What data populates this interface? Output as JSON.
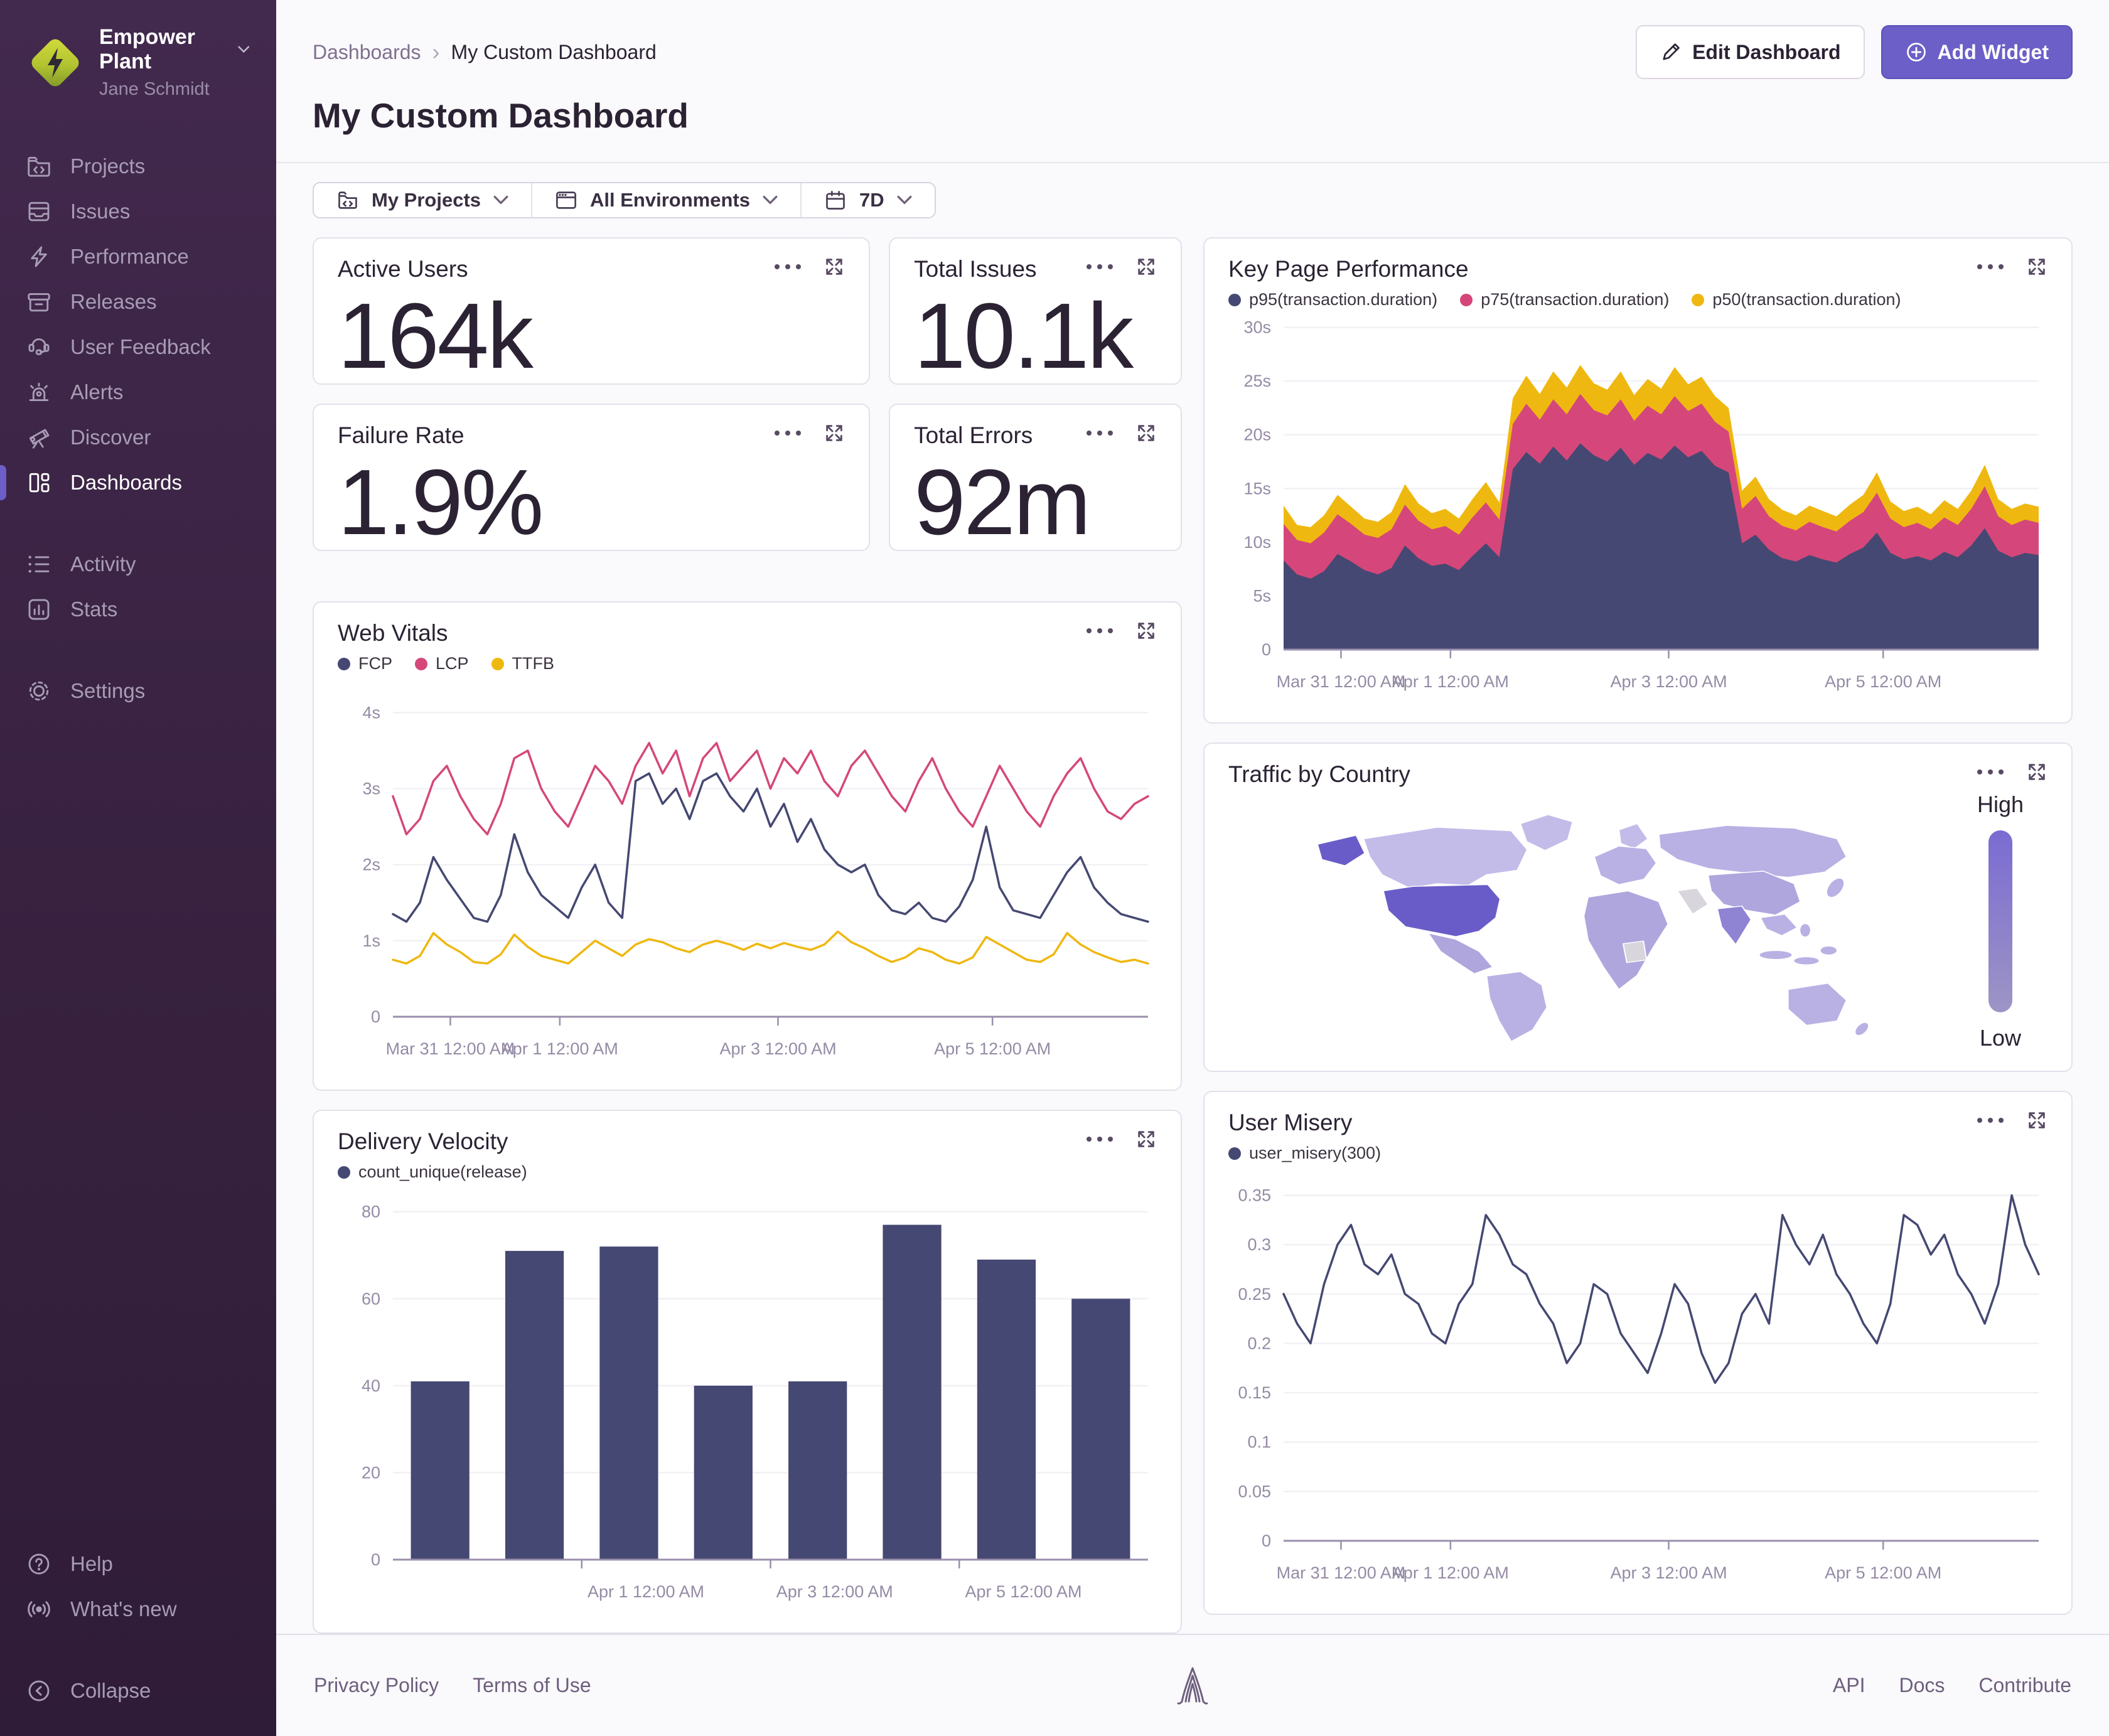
{
  "app": {
    "accent": "#6C5FC7",
    "sidebar_bg": "#37213F",
    "chart_navy": "#454872",
    "chart_pink": "#D5477A",
    "chart_yellow": "#EFB810"
  },
  "sidebar": {
    "org_name": "Empower Plant",
    "user_name": "Jane Schmidt",
    "items": [
      {
        "label": "Projects"
      },
      {
        "label": "Issues"
      },
      {
        "label": "Performance"
      },
      {
        "label": "Releases"
      },
      {
        "label": "User Feedback"
      },
      {
        "label": "Alerts"
      },
      {
        "label": "Discover"
      },
      {
        "label": "Dashboards"
      }
    ],
    "secondary": [
      {
        "label": "Activity"
      },
      {
        "label": "Stats"
      }
    ],
    "settings_label": "Settings",
    "help_label": "Help",
    "whats_new_label": "What's new",
    "collapse_label": "Collapse"
  },
  "header": {
    "breadcrumb_root": "Dashboards",
    "breadcrumb_current": "My Custom Dashboard",
    "title": "My Custom Dashboard",
    "edit_button": "Edit Dashboard",
    "add_button": "Add Widget"
  },
  "filters": {
    "projects": "My Projects",
    "environments": "All Environments",
    "time_range": "7D"
  },
  "widgets": {
    "active_users": {
      "title": "Active Users",
      "value": "164k"
    },
    "total_issues": {
      "title": "Total Issues",
      "value": "10.1k"
    },
    "failure_rate": {
      "title": "Failure Rate",
      "value": "1.9%"
    },
    "total_errors": {
      "title": "Total Errors",
      "value": "92m"
    }
  },
  "footer": {
    "privacy": "Privacy Policy",
    "terms": "Terms of Use",
    "api": "API",
    "docs": "Docs",
    "contribute": "Contribute"
  },
  "chart_data": [
    {
      "type": "area",
      "stacked": true,
      "title": "Key Page Performance",
      "ymax": 30.5,
      "y_ticks": [
        {
          "v": 30,
          "label": "30s"
        },
        {
          "v": 25,
          "label": "25s"
        },
        {
          "v": 20,
          "label": "20s"
        },
        {
          "v": 15,
          "label": "15s"
        },
        {
          "v": 10,
          "label": "10s"
        },
        {
          "v": 5,
          "label": "5s"
        },
        {
          "v": 0,
          "label": "0"
        }
      ],
      "x_ticks": [
        {
          "f": 0.076,
          "label": "Mar 31 12:00 AM"
        },
        {
          "f": 0.221,
          "label": "Apr 1 12:00 AM"
        },
        {
          "f": 0.51,
          "label": "Apr 3 12:00 AM"
        },
        {
          "f": 0.794,
          "label": "Apr 5 12:00 AM"
        }
      ],
      "series": [
        {
          "name": "p95(transaction.duration)",
          "color": "#454872",
          "values": [
            8.3,
            7.0,
            6.6,
            7.3,
            8.9,
            8.2,
            7.4,
            7.0,
            7.6,
            9.7,
            8.5,
            7.8,
            8.0,
            7.4,
            8.7,
            9.9,
            8.6,
            16.8,
            18.4,
            17.3,
            18.9,
            17.6,
            19.2,
            18.1,
            17.5,
            18.8,
            17.2,
            18.3,
            17.7,
            19.0,
            17.9,
            18.5,
            17.1,
            16.5,
            9.9,
            10.7,
            9.3,
            8.5,
            8.2,
            8.8,
            8.4,
            8.1,
            8.9,
            9.5,
            10.9,
            9.0,
            8.4,
            8.7,
            8.3,
            9.1,
            8.6,
            9.7,
            11.3,
            9.2,
            8.6,
            9.0,
            8.8
          ]
        },
        {
          "name": "p75(transaction.duration)",
          "color": "#D5477A",
          "values": [
            3.4,
            3.2,
            3.3,
            3.6,
            3.7,
            3.5,
            3.3,
            3.4,
            3.6,
            3.8,
            3.5,
            3.4,
            3.5,
            3.3,
            3.6,
            3.8,
            3.5,
            4.2,
            4.5,
            4.1,
            4.4,
            4.3,
            4.6,
            4.2,
            4.3,
            4.5,
            4.1,
            4.4,
            4.2,
            4.6,
            4.3,
            4.4,
            4.1,
            3.8,
            3.2,
            3.6,
            3.1,
            3.0,
            2.9,
            3.1,
            3.0,
            2.9,
            3.1,
            3.3,
            3.7,
            3.2,
            3.0,
            3.1,
            2.9,
            3.2,
            3.0,
            3.4,
            3.9,
            3.2,
            3.0,
            3.1,
            3.0
          ]
        },
        {
          "name": "p50(transaction.duration)",
          "color": "#EFB810",
          "values": [
            1.7,
            1.4,
            1.5,
            1.6,
            1.8,
            1.6,
            1.5,
            1.5,
            1.6,
            1.9,
            1.6,
            1.5,
            1.6,
            1.5,
            1.7,
            1.9,
            1.6,
            2.4,
            2.6,
            2.4,
            2.6,
            2.5,
            2.7,
            2.5,
            2.4,
            2.6,
            2.4,
            2.5,
            2.4,
            2.7,
            2.5,
            2.5,
            2.4,
            2.2,
            1.7,
            1.8,
            1.6,
            1.5,
            1.4,
            1.5,
            1.5,
            1.4,
            1.5,
            1.6,
            1.9,
            1.6,
            1.5,
            1.5,
            1.4,
            1.6,
            1.5,
            1.7,
            2.0,
            1.6,
            1.5,
            1.5,
            1.5
          ]
        }
      ]
    },
    {
      "type": "line",
      "title": "Web Vitals",
      "ymax": 4.35,
      "y_ticks": [
        {
          "v": 4,
          "label": "4s"
        },
        {
          "v": 3,
          "label": "3s"
        },
        {
          "v": 2,
          "label": "2s"
        },
        {
          "v": 1,
          "label": "1s"
        },
        {
          "v": 0,
          "label": "0"
        }
      ],
      "x_ticks": [
        {
          "f": 0.076,
          "label": "Mar 31 12:00 AM"
        },
        {
          "f": 0.221,
          "label": "Apr 1 12:00 AM"
        },
        {
          "f": 0.51,
          "label": "Apr 3 12:00 AM"
        },
        {
          "f": 0.794,
          "label": "Apr 5 12:00 AM"
        }
      ],
      "series": [
        {
          "name": "FCP",
          "color": "#454872",
          "values": [
            1.35,
            1.25,
            1.5,
            2.1,
            1.8,
            1.55,
            1.3,
            1.25,
            1.6,
            2.4,
            1.9,
            1.6,
            1.45,
            1.3,
            1.7,
            2.0,
            1.5,
            1.3,
            3.1,
            3.2,
            2.8,
            3.0,
            2.6,
            3.1,
            3.2,
            2.9,
            2.7,
            3.0,
            2.5,
            2.8,
            2.3,
            2.6,
            2.2,
            2.0,
            1.9,
            2.0,
            1.6,
            1.4,
            1.35,
            1.5,
            1.3,
            1.25,
            1.45,
            1.8,
            2.5,
            1.7,
            1.4,
            1.35,
            1.3,
            1.6,
            1.9,
            2.1,
            1.7,
            1.5,
            1.35,
            1.3,
            1.25
          ]
        },
        {
          "name": "LCP",
          "color": "#D5477A",
          "values": [
            2.9,
            2.4,
            2.6,
            3.1,
            3.3,
            2.9,
            2.6,
            2.4,
            2.8,
            3.4,
            3.5,
            3.0,
            2.7,
            2.5,
            2.9,
            3.3,
            3.1,
            2.8,
            3.3,
            3.6,
            3.2,
            3.5,
            2.9,
            3.4,
            3.6,
            3.1,
            3.3,
            3.5,
            3.0,
            3.4,
            3.2,
            3.5,
            3.1,
            2.9,
            3.3,
            3.5,
            3.2,
            2.9,
            2.7,
            3.1,
            3.4,
            3.0,
            2.7,
            2.5,
            2.9,
            3.3,
            3.0,
            2.7,
            2.5,
            2.9,
            3.2,
            3.4,
            3.0,
            2.7,
            2.6,
            2.8,
            2.9
          ]
        },
        {
          "name": "TTFB",
          "color": "#EFB810",
          "values": [
            0.75,
            0.7,
            0.8,
            1.1,
            0.95,
            0.85,
            0.72,
            0.7,
            0.82,
            1.08,
            0.92,
            0.8,
            0.75,
            0.7,
            0.85,
            1.0,
            0.9,
            0.8,
            0.95,
            1.02,
            0.98,
            0.9,
            0.85,
            0.95,
            1.0,
            0.95,
            0.88,
            0.96,
            0.9,
            0.97,
            0.92,
            0.88,
            0.95,
            1.12,
            0.98,
            0.9,
            0.8,
            0.72,
            0.78,
            0.9,
            0.85,
            0.75,
            0.7,
            0.78,
            1.05,
            0.95,
            0.85,
            0.75,
            0.72,
            0.82,
            1.1,
            0.95,
            0.85,
            0.78,
            0.72,
            0.75,
            0.7
          ]
        }
      ]
    },
    {
      "type": "choropleth",
      "title": "Traffic by Country",
      "legend_high": "High",
      "legend_low": "Low",
      "highest_country": "United States",
      "palette": {
        "us": "#6A5CC8",
        "base": "#B9B1E4",
        "light": "#C3BCE9",
        "mid": "#AFA6DE",
        "dark_mid": "#8F83D4",
        "nodata": "#D8D5DC",
        "legend_top": "#7A6BD2",
        "legend_bottom": "#9D95C5"
      }
    },
    {
      "type": "bar",
      "title": "Delivery Velocity",
      "ymax": 84,
      "y_ticks": [
        {
          "v": 80,
          "label": "80"
        },
        {
          "v": 60,
          "label": "60"
        },
        {
          "v": 40,
          "label": "40"
        },
        {
          "v": 20,
          "label": "20"
        },
        {
          "v": 0,
          "label": "0"
        }
      ],
      "x_ticks": [
        {
          "f": 0.335,
          "tf": 0.25,
          "label": "Apr 1 12:00 AM"
        },
        {
          "f": 0.585,
          "tf": 0.5,
          "label": "Apr 3 12:00 AM"
        },
        {
          "f": 0.835,
          "tf": 0.75,
          "label": "Apr 5 12:00 AM"
        }
      ],
      "series": [
        {
          "name": "count_unique(release)",
          "color": "#454872",
          "values": [
            41,
            71,
            72,
            40,
            41,
            77,
            69,
            60
          ]
        }
      ]
    },
    {
      "type": "line",
      "title": "User Misery",
      "ymax": 0.37,
      "y_ticks": [
        {
          "v": 0.35,
          "label": "0.35"
        },
        {
          "v": 0.3,
          "label": "0.3"
        },
        {
          "v": 0.25,
          "label": "0.25"
        },
        {
          "v": 0.2,
          "label": "0.2"
        },
        {
          "v": 0.15,
          "label": "0.15"
        },
        {
          "v": 0.1,
          "label": "0.1"
        },
        {
          "v": 0.05,
          "label": "0.05"
        },
        {
          "v": 0,
          "label": "0"
        }
      ],
      "x_ticks": [
        {
          "f": 0.076,
          "label": "Mar 31 12:00 AM"
        },
        {
          "f": 0.221,
          "label": "Apr 1 12:00 AM"
        },
        {
          "f": 0.51,
          "label": "Apr 3 12:00 AM"
        },
        {
          "f": 0.794,
          "label": "Apr 5 12:00 AM"
        }
      ],
      "series": [
        {
          "name": "user_misery(300)",
          "color": "#454872",
          "values": [
            0.25,
            0.22,
            0.2,
            0.26,
            0.3,
            0.32,
            0.28,
            0.27,
            0.29,
            0.25,
            0.24,
            0.21,
            0.2,
            0.24,
            0.26,
            0.33,
            0.31,
            0.28,
            0.27,
            0.24,
            0.22,
            0.18,
            0.2,
            0.26,
            0.25,
            0.21,
            0.19,
            0.17,
            0.21,
            0.26,
            0.24,
            0.19,
            0.16,
            0.18,
            0.23,
            0.25,
            0.22,
            0.33,
            0.3,
            0.28,
            0.31,
            0.27,
            0.25,
            0.22,
            0.2,
            0.24,
            0.33,
            0.32,
            0.29,
            0.31,
            0.27,
            0.25,
            0.22,
            0.26,
            0.35,
            0.3,
            0.27
          ]
        }
      ]
    }
  ]
}
